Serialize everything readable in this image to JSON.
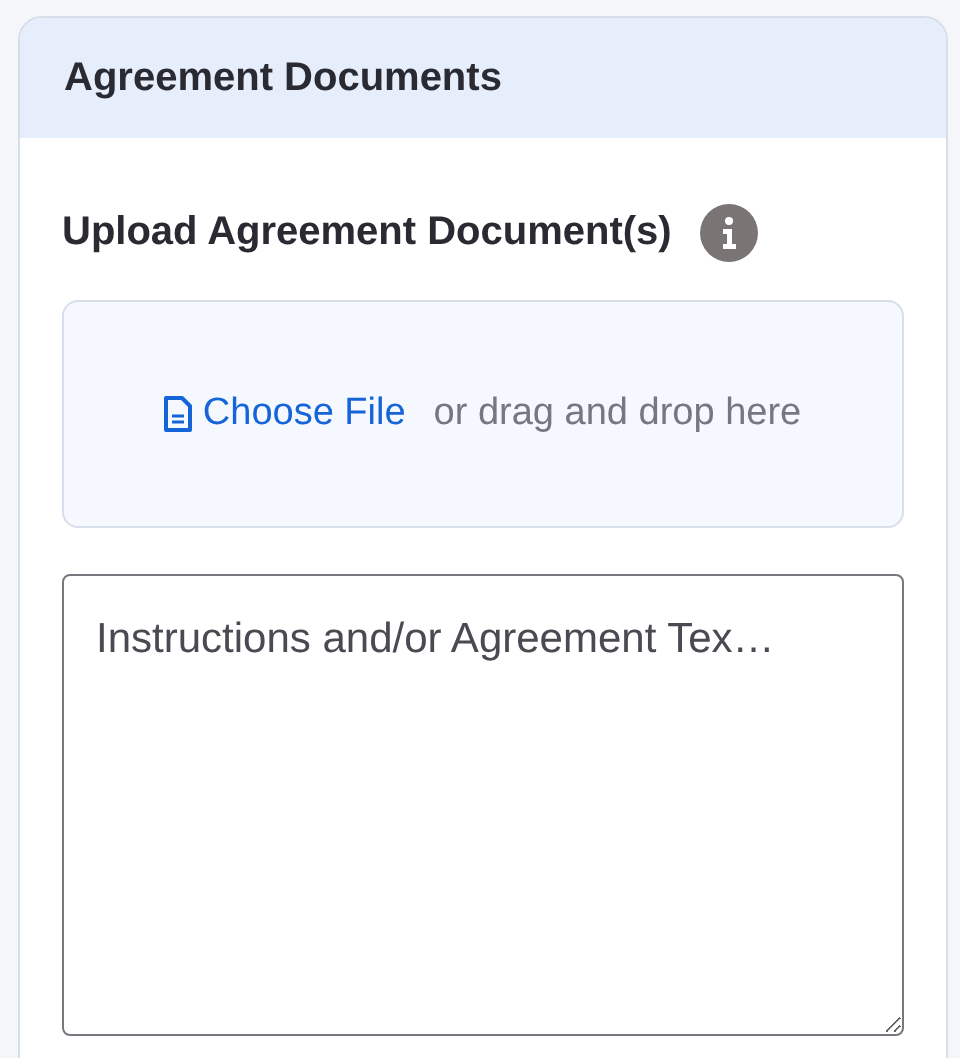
{
  "card": {
    "title": "Agreement Documents"
  },
  "upload": {
    "label": "Upload Agreement Document(s)",
    "choose_file": "Choose File",
    "drop_hint": "or drag and drop here"
  },
  "text_field": {
    "placeholder": "Instructions and/or Agreement Tex…"
  }
}
